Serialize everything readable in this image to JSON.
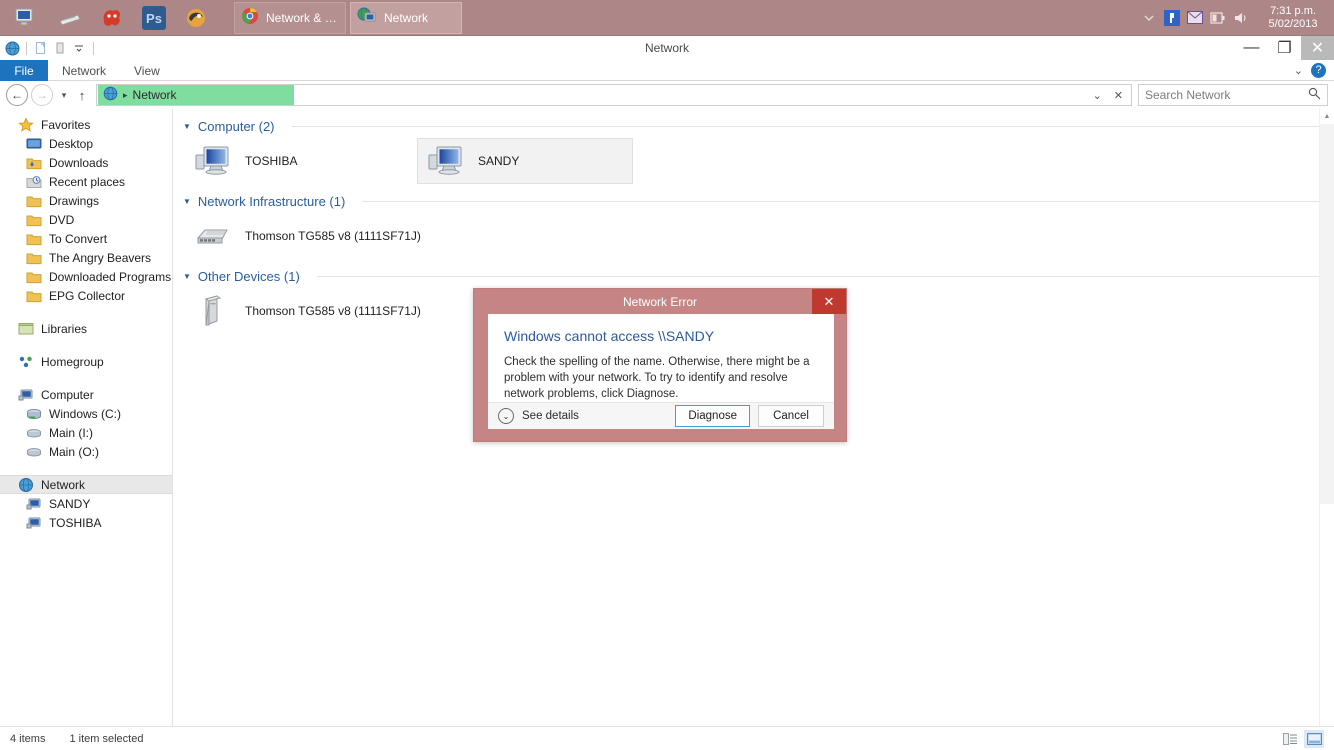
{
  "taskbar": {
    "quick_launch": [
      {
        "name": "computer-icon",
        "label": "Computer"
      },
      {
        "name": "scanner-icon",
        "label": "Scanner"
      },
      {
        "name": "gimp-icon",
        "label": "GIMP"
      },
      {
        "name": "photoshop-icon",
        "label": "Ps"
      },
      {
        "name": "firefox-icon",
        "label": "Firefox"
      }
    ],
    "tasks": [
      {
        "name": "taskbar-chrome",
        "label": "Network & S...",
        "icon": "chrome-icon",
        "active": false
      },
      {
        "name": "taskbar-explorer",
        "label": "Network",
        "icon": "network-icon",
        "active": true
      }
    ],
    "tray": [
      {
        "name": "tray-overflow-chevron",
        "glyph": "▼"
      },
      {
        "name": "tray-action-center-icon",
        "glyph": "⚑"
      },
      {
        "name": "tray-mail-icon",
        "glyph": "✉"
      },
      {
        "name": "tray-battery-icon",
        "glyph": "▮"
      },
      {
        "name": "tray-volume-icon",
        "glyph": "🔊"
      }
    ],
    "clock_time": "7:31 p.m.",
    "clock_date": "5/02/2013"
  },
  "window": {
    "title": "Network",
    "quick_access": [
      "network-globe-icon",
      "properties-icon",
      "delete-icon",
      "customize-dropdown-icon"
    ],
    "controls": {
      "minimize": "—",
      "restore": "❐",
      "close": "✕"
    }
  },
  "ribbon": {
    "tabs": [
      {
        "label": "File",
        "selected": true
      },
      {
        "label": "Network",
        "selected": false
      },
      {
        "label": "View",
        "selected": false
      }
    ],
    "collapse_chevron": "⌄",
    "help_glyph": "?"
  },
  "navbar": {
    "back_glyph": "←",
    "forward_glyph": "→",
    "recent_glyph": "▾",
    "up_glyph": "↑",
    "breadcrumb": {
      "icon": "network-globe-icon",
      "separator": "▸",
      "path": "Network"
    },
    "dropdown_glyph": "⌄",
    "refresh_glyph": "✕",
    "search_placeholder": "Search Network",
    "search_value": "",
    "search_icon": "🔍"
  },
  "sidebar": {
    "items": [
      {
        "label": "Favorites",
        "icon": "star-icon",
        "indent": false,
        "selected": false
      },
      {
        "label": "Desktop",
        "icon": "desktop-icon",
        "indent": true,
        "selected": false
      },
      {
        "label": "Downloads",
        "icon": "downloads-folder-icon",
        "indent": true,
        "selected": false
      },
      {
        "label": "Recent places",
        "icon": "recent-places-icon",
        "indent": true,
        "selected": false
      },
      {
        "label": "Drawings",
        "icon": "folder-icon",
        "indent": true,
        "selected": false
      },
      {
        "label": "DVD",
        "icon": "folder-icon",
        "indent": true,
        "selected": false
      },
      {
        "label": "To Convert",
        "icon": "folder-icon",
        "indent": true,
        "selected": false
      },
      {
        "label": "The Angry Beavers",
        "icon": "folder-icon",
        "indent": true,
        "selected": false
      },
      {
        "label": "Downloaded Programs",
        "icon": "folder-icon",
        "indent": true,
        "selected": false
      },
      {
        "label": "EPG Collector",
        "icon": "folder-icon",
        "indent": true,
        "selected": false
      },
      {
        "gap": true
      },
      {
        "label": "Libraries",
        "icon": "libraries-icon",
        "indent": false,
        "selected": false
      },
      {
        "gap": true
      },
      {
        "label": "Homegroup",
        "icon": "homegroup-icon",
        "indent": false,
        "selected": false
      },
      {
        "gap": true
      },
      {
        "label": "Computer",
        "icon": "computer-icon",
        "indent": false,
        "selected": false
      },
      {
        "label": "Windows (C:)",
        "icon": "harddisk-icon",
        "indent": true,
        "selected": false
      },
      {
        "label": "Main (I:)",
        "icon": "drive-icon",
        "indent": true,
        "selected": false
      },
      {
        "label": "Main (O:)",
        "icon": "drive-icon",
        "indent": true,
        "selected": false
      },
      {
        "gap": true
      },
      {
        "label": "Network",
        "icon": "network-globe-icon",
        "indent": false,
        "selected": true
      },
      {
        "label": "SANDY",
        "icon": "computer-small-icon",
        "indent": true,
        "selected": false
      },
      {
        "label": "TOSHIBA",
        "icon": "computer-small-icon",
        "indent": true,
        "selected": false
      }
    ]
  },
  "filepane": {
    "groups": [
      {
        "header": "Computer (2)",
        "items": [
          {
            "label": "TOSHIBA",
            "icon": "computer-icon",
            "selected": false
          },
          {
            "label": "SANDY",
            "icon": "computer-icon",
            "selected": true
          }
        ]
      },
      {
        "header": "Network Infrastructure (1)",
        "items": [
          {
            "label": "Thomson TG585 v8 (1111SF71J)",
            "icon": "router-icon",
            "selected": false
          }
        ]
      },
      {
        "header": "Other Devices (1)",
        "items": [
          {
            "label": "Thomson TG585 v8 (1111SF71J)",
            "icon": "device-tower-icon",
            "selected": false
          }
        ]
      }
    ]
  },
  "statusbar": {
    "item_count": "4 items",
    "selection": "1 item selected",
    "views": [
      {
        "name": "details-view-button",
        "active": false
      },
      {
        "name": "large-icons-view-button",
        "active": true
      }
    ]
  },
  "dialog": {
    "title": "Network Error",
    "close_glyph": "✕",
    "heading": "Windows cannot access \\\\SANDY",
    "body": "Check the spelling of the name. Otherwise, there might be a problem with your network. To try to identify and resolve network problems, click Diagnose.",
    "see_details_label": "See details",
    "see_details_glyph": "⌄",
    "buttons": [
      {
        "label": "Diagnose",
        "default": true
      },
      {
        "label": "Cancel",
        "default": false
      }
    ]
  },
  "colors": {
    "taskbar": "#ad8787",
    "dialog_frame": "#c68585",
    "dialog_close": "#c0392f",
    "accent_blue": "#1e73be",
    "heading_blue": "#2b5a9b",
    "group_header_blue": "#2a5d9e",
    "breadcrumb_highlight": "#7fdd9f",
    "file_tab": "#1e73be"
  }
}
